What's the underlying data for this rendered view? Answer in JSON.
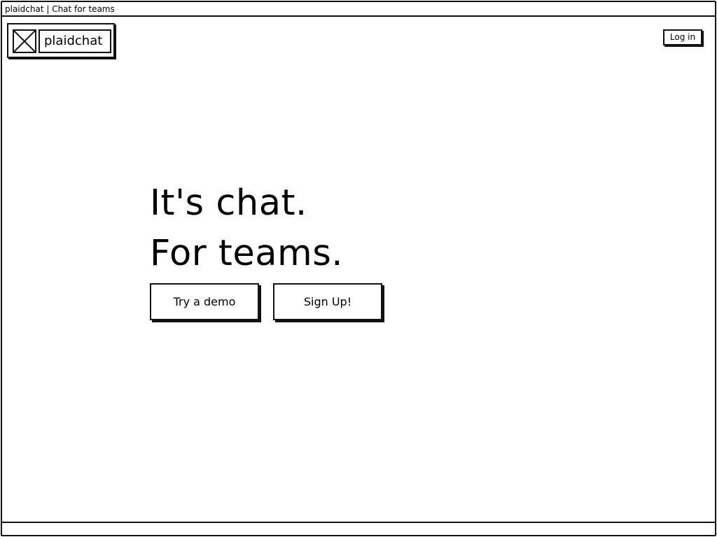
{
  "window": {
    "title": "plaidchat | Chat for teams"
  },
  "header": {
    "logo_icon": "image-placeholder-icon",
    "logo_text": "plaidchat",
    "login_label": "Log in"
  },
  "hero": {
    "line1": "It's chat.",
    "line2": "For teams."
  },
  "actions": {
    "demo_label": "Try a demo",
    "signup_label": "Sign Up!"
  }
}
